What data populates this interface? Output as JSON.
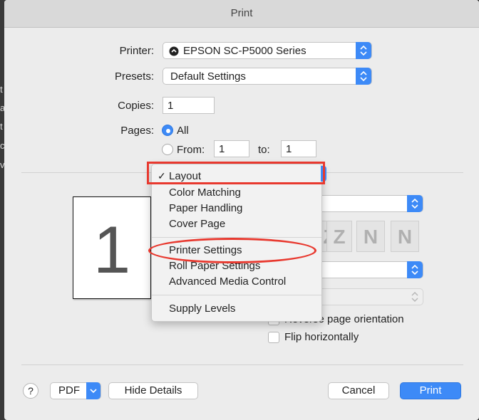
{
  "window": {
    "title": "Print"
  },
  "printer": {
    "label": "Printer:",
    "value": "EPSON SC-P5000 Series"
  },
  "presets": {
    "label": "Presets:",
    "value": "Default Settings"
  },
  "copies": {
    "label": "Copies:",
    "value": "1"
  },
  "pages": {
    "label": "Pages:",
    "all_label": "All",
    "from_label": "From:",
    "from_value": "1",
    "to_label": "to:",
    "to_value": "1"
  },
  "preview": {
    "page_number": "1"
  },
  "menu": {
    "items": [
      {
        "label": "Layout",
        "checked": true
      },
      {
        "label": "Color Matching"
      },
      {
        "label": "Paper Handling"
      },
      {
        "label": "Cover Page"
      },
      {
        "label": "Printer Settings"
      },
      {
        "label": "Roll Paper Settings"
      },
      {
        "label": "Advanced Media Control"
      },
      {
        "label": "Supply Levels"
      }
    ],
    "check_glyph": "✓"
  },
  "layout_direction": [
    "Z",
    "Z",
    "N",
    "N"
  ],
  "options": {
    "reverse_label": "Reverse page orientation",
    "flip_label": "Flip horizontally"
  },
  "footer": {
    "help": "?",
    "pdf_label": "PDF",
    "hide_details_label": "Hide Details",
    "cancel_label": "Cancel",
    "print_label": "Print"
  },
  "background": {
    "letters": [
      "t",
      "a",
      "t",
      "c",
      "v"
    ]
  },
  "colors": {
    "accent": "#3d8af7",
    "highlight_box": "#e8392f",
    "highlight_oval": "#e8392f"
  }
}
